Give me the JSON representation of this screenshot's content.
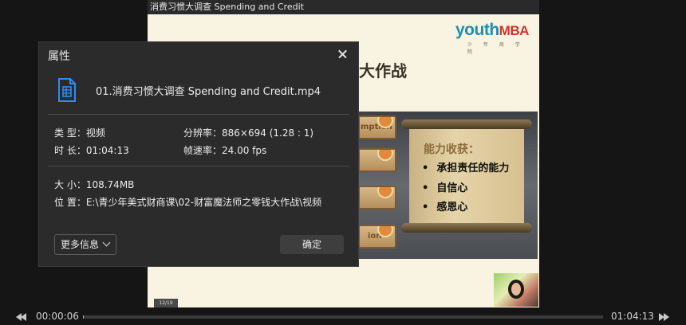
{
  "video": {
    "title": "消费习惯大调查 Spending and Credit",
    "slide": {
      "logo_main": "youth",
      "logo_accent": "MBA",
      "logo_sub": "少 年 商 学 院",
      "heading": "大作战",
      "tiles": [
        "mption",
        "",
        "",
        "ion"
      ],
      "scroll_heading": "能力收获：",
      "scroll_items": [
        "承担责任的能力",
        "自信心",
        "感恩心"
      ],
      "page_number": "12/19"
    }
  },
  "dialog": {
    "title": "属性",
    "file_name": "01.消费习惯大调查 Spending and Credit.mp4",
    "type_label": "类  型：",
    "type_value": "视频",
    "duration_label": "时  长：",
    "duration_value": "01:04:13",
    "resolution_label": "分辨率：",
    "resolution_value": "886×694 (1.28 : 1)",
    "framerate_label": "帧速率：",
    "framerate_value": "24.00 fps",
    "size_label": "大  小：",
    "size_value": "108.74MB",
    "location_label": "位  置：",
    "location_value": "E:\\青少年美式财商课\\02-财富魔法师之零钱大作战\\视频",
    "more_button": "更多信息",
    "ok_button": "确定"
  },
  "player": {
    "current_time": "00:00:06",
    "total_time": "01:04:13",
    "progress_fraction": 0.0016
  },
  "colors": {
    "dialog_bg": "#2b2b2b",
    "file_icon": "#2f8cf0",
    "logo_blue": "#1b8fb4",
    "logo_red": "#d2332b"
  },
  "icons": [
    "file-video-icon",
    "close-icon",
    "chevron-down-icon",
    "rewind-icon",
    "fast-forward-icon"
  ]
}
